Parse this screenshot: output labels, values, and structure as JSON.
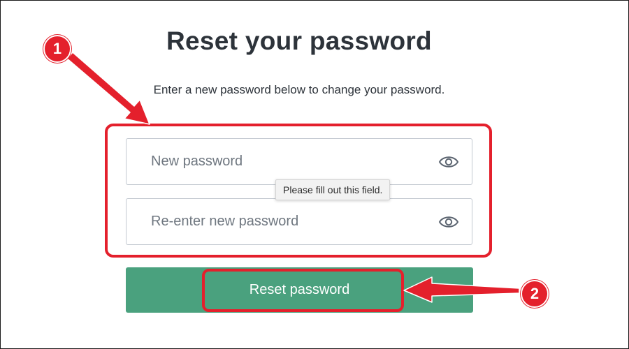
{
  "form": {
    "title": "Reset your password",
    "subtitle": "Enter a new password below to change your password.",
    "new_password_placeholder": "New password",
    "reenter_password_placeholder": "Re-enter new password",
    "validation_tooltip": "Please fill out this field.",
    "submit_label": "Reset password"
  },
  "annotations": {
    "step_1": "1",
    "step_2": "2",
    "highlight_color": "#e4202c"
  },
  "icons": {
    "toggle_visibility": "eye-icon"
  },
  "colors": {
    "primary_button": "#4aa17e",
    "text": "#2d333a",
    "field_border": "#c2c8d0"
  }
}
